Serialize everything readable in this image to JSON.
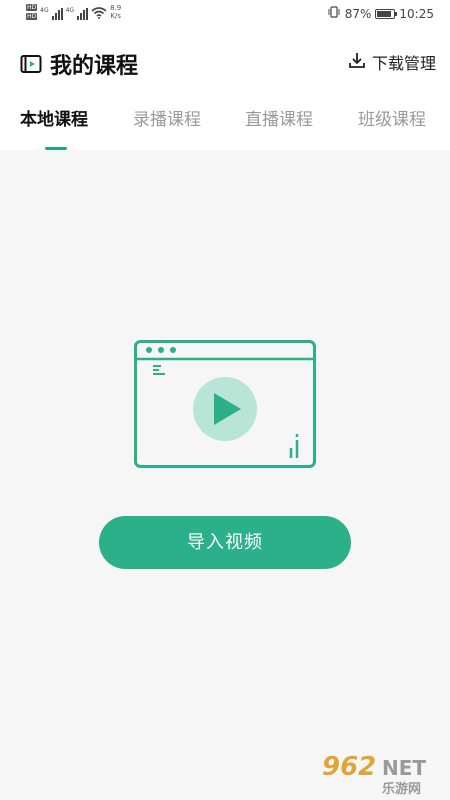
{
  "status_bar": {
    "hd1": "HD",
    "hd2": "HD",
    "net1": "4G",
    "net2": "4G",
    "speed_value": "8.9",
    "speed_unit": "K/s",
    "battery_percent": "87%",
    "battery_level": 0.87,
    "time": "10:25"
  },
  "header": {
    "title": "我的课程",
    "download_label": "下载管理"
  },
  "tabs": [
    {
      "label": "本地课程",
      "active": true
    },
    {
      "label": "录播课程",
      "active": false
    },
    {
      "label": "直播课程",
      "active": false
    },
    {
      "label": "班级课程",
      "active": false
    }
  ],
  "main": {
    "import_button_label": "导入视频"
  },
  "watermark": {
    "number": "962",
    "net": "NET",
    "sub": "乐游网"
  },
  "colors": {
    "accent": "#2bb08a",
    "accent_light": "#b9e5d6",
    "background": "#f6f6f6"
  },
  "icons": {
    "title": "video-icon",
    "download": "download-icon",
    "illustration": "video-player-illustration"
  }
}
